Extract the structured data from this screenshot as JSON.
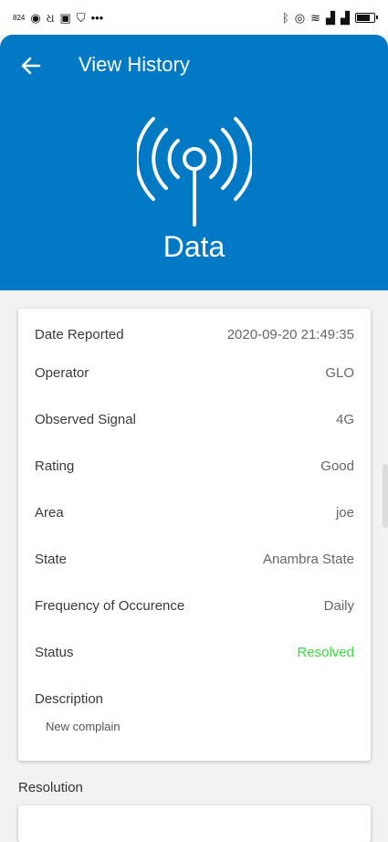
{
  "status_bar": {
    "time": "824"
  },
  "header": {
    "title": "View History",
    "subtitle": "Data"
  },
  "details": {
    "rows": [
      {
        "label": "Date Reported",
        "value": "2020-09-20 21:49:35"
      },
      {
        "label": "Operator",
        "value": "GLO"
      },
      {
        "label": "Observed Signal",
        "value": "4G"
      },
      {
        "label": "Rating",
        "value": "Good"
      },
      {
        "label": "Area",
        "value": "joe"
      },
      {
        "label": "State",
        "value": "Anambra State"
      },
      {
        "label": "Frequency of Occurence",
        "value": "Daily"
      },
      {
        "label": "Status",
        "value": "Resolved"
      }
    ],
    "description_label": "Description",
    "description_value": "New complain"
  },
  "resolution": {
    "label": "Resolution"
  },
  "colors": {
    "header_bg": "#0179c5",
    "status_resolved": "#3ddc3d"
  },
  "icons": [
    "arrow-back-icon",
    "signal-tower-icon"
  ]
}
